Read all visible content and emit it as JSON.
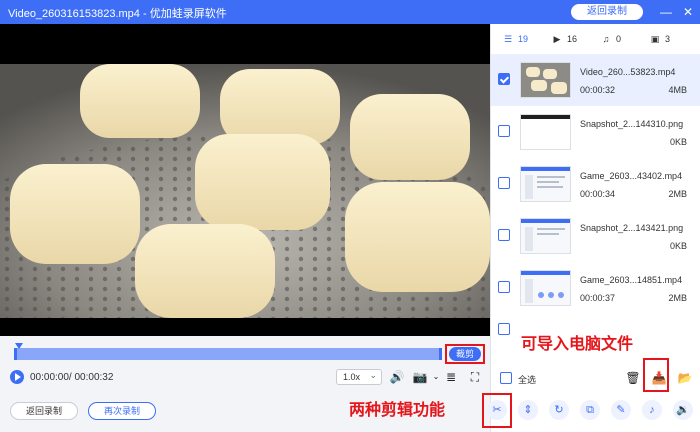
{
  "window": {
    "title": "Video_260316153823.mp4 - 优加蛙录屏软件",
    "return_button": "返回录制",
    "minimize_icon": "minimize-icon",
    "close_icon": "close-icon"
  },
  "player": {
    "cut_label": "裁剪",
    "time": "00:00:00/ 00:00:32",
    "speed": "1.0x"
  },
  "bottom": {
    "back_label": "返回录制",
    "again_label": "再次录制"
  },
  "tabs": [
    {
      "icon": "list-icon",
      "count": "19"
    },
    {
      "icon": "video-icon",
      "count": "16"
    },
    {
      "icon": "music-icon",
      "count": "0"
    },
    {
      "icon": "image-icon",
      "count": "3"
    }
  ],
  "files": [
    {
      "name": "Video_260...53823.mp4",
      "duration": "00:00:32",
      "size": "4MB",
      "checked": true
    },
    {
      "name": "Snapshot_2...144310.png",
      "duration": "",
      "size": "0KB",
      "checked": false
    },
    {
      "name": "Game_2603...43402.mp4",
      "duration": "00:00:34",
      "size": "2MB",
      "checked": false
    },
    {
      "name": "Snapshot_2...143421.png",
      "duration": "",
      "size": "0KB",
      "checked": false
    },
    {
      "name": "Game_2603...14851.mp4",
      "duration": "00:00:37",
      "size": "2MB",
      "checked": false
    },
    {
      "name": "",
      "duration": "",
      "size": "",
      "checked": false
    }
  ],
  "footer": {
    "select_all": "全选"
  },
  "annotations": {
    "import": "可导入电脑文件",
    "edit": "两种剪辑功能"
  },
  "colors": {
    "accent": "#3d6ef5",
    "highlight": "#e5161b"
  }
}
